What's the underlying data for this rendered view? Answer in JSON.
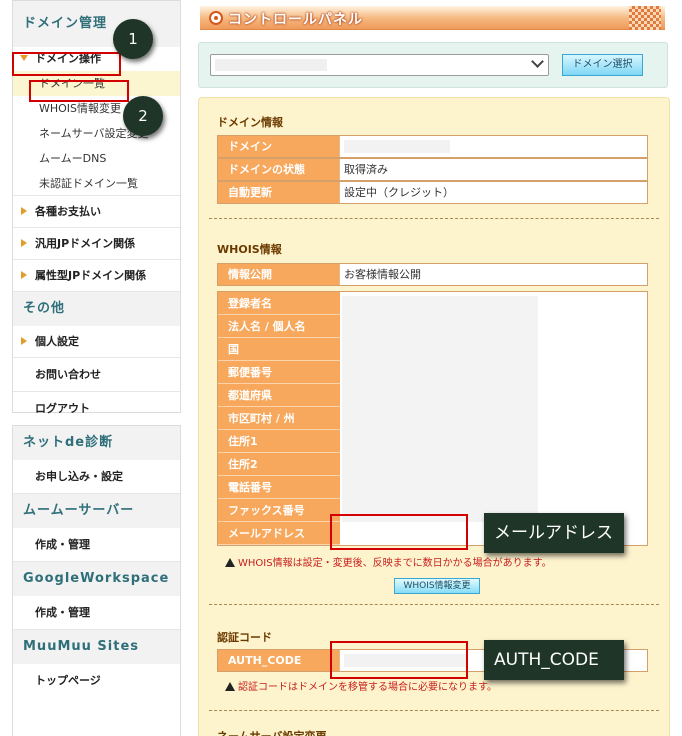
{
  "sidebar": {
    "domain_head": "ドメイン管理",
    "domain_ops": "ドメイン操作",
    "domain_list": "ドメイン一覧",
    "whois_change": "WHOIS情報変更",
    "ns_change": "ネームサーバ設定変更",
    "muumu_dns": "ムームーDNS",
    "unverified": "未認証ドメイン一覧",
    "payments": "各種お支払い",
    "general_jp": "汎用JPドメイン関係",
    "attr_jp": "属性型JPドメイン関係",
    "other_head": "その他",
    "personal": "個人設定",
    "contact": "お問い合わせ",
    "logout": "ログアウト",
    "net_head": "ネットde診断",
    "net_item": "お申し込み・設定",
    "server_head": "ムームーサーバー",
    "server_item": "作成・管理",
    "gws_head": "GoogleWorkspace",
    "gws_item": "作成・管理",
    "sites_head": "MuuMuu Sites",
    "sites_item": "トップページ"
  },
  "badges": {
    "one": "1",
    "two": "2"
  },
  "header": {
    "title": "コントロールパネル"
  },
  "domain_select": {
    "button": "ドメイン選択"
  },
  "domain_info": {
    "title": "ドメイン情報",
    "rows": [
      {
        "label": "ドメイン",
        "value": ""
      },
      {
        "label": "ドメインの状態",
        "value": "取得済み"
      },
      {
        "label": "自動更新",
        "value": "設定中（クレジット）"
      }
    ]
  },
  "whois": {
    "title": "WHOIS情報",
    "disclosure_label": "情報公開",
    "disclosure_value": "お客様情報公開",
    "fields": [
      "登録者名",
      "法人名 / 個人名",
      "国",
      "郵便番号",
      "都道府県",
      "市区町村 / 州",
      "住所1",
      "住所2",
      "電話番号",
      "ファックス番号",
      "メールアドレス"
    ],
    "notice": "WHOIS情報は設定・変更後、反映までに数日かかる場合があります。",
    "button": "WHOIS情報変更"
  },
  "auth": {
    "title": "認証コード",
    "label": "AUTH_CODE",
    "notice": "認証コードはドメインを移管する場合に必要になります。"
  },
  "ns": {
    "title": "ネームサーバ設定変更"
  },
  "callouts": {
    "email": "メールアドレス",
    "auth": "AUTH_CODE"
  },
  "colors": {
    "accent_orange": "#f7a85c",
    "panel": "#fdf3cc",
    "highlight": "#d40000",
    "callout": "#1e3527"
  }
}
